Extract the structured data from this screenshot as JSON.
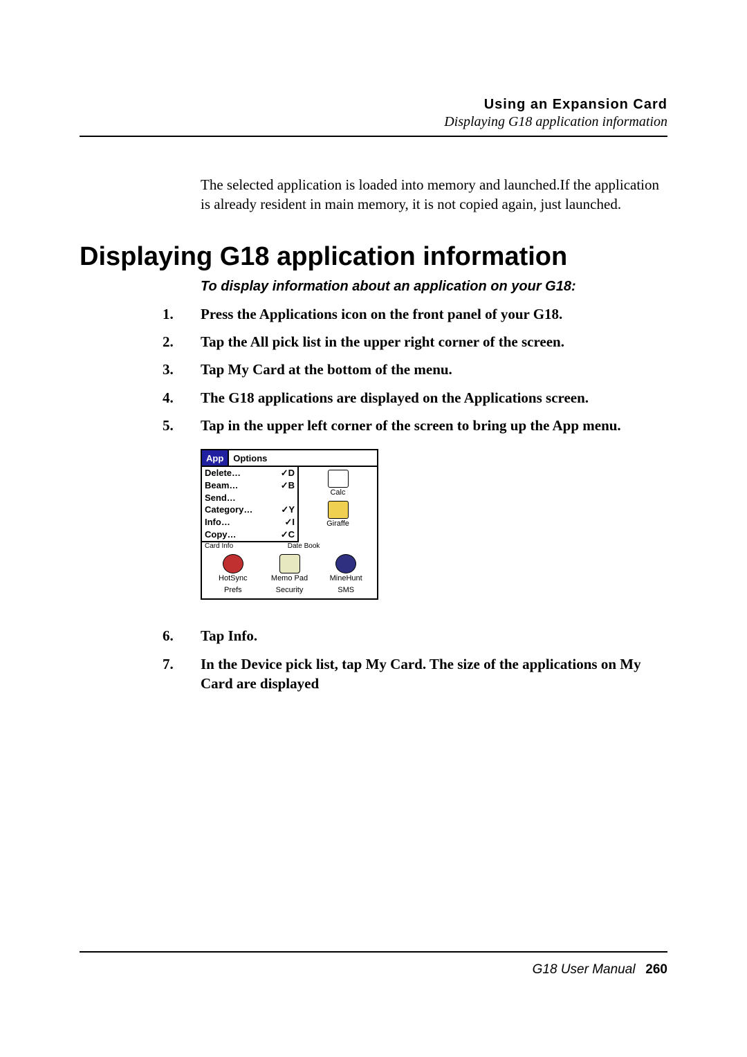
{
  "header": {
    "chapter": "Using an Expansion Card",
    "section": "Displaying G18 application information"
  },
  "intro": "The selected application is loaded into memory and launched.If the application is already resident in main memory, it is not copied again, just launched.",
  "heading": "Displaying G18 application information",
  "subhead": "To display information about an application on your  G18:",
  "steps1": [
    {
      "n": "1.",
      "t": "Press the Applications icon on the front panel of your G18."
    },
    {
      "n": "2.",
      "t": "Tap the All pick list in the upper right corner of the screen."
    },
    {
      "n": "3.",
      "t": "Tap My Card at the bottom of the menu."
    },
    {
      "n": "4.",
      "t": "The G18 applications are displayed on the Applications screen."
    },
    {
      "n": "5.",
      "t": "Tap in the upper left corner of the screen to bring up the App menu."
    }
  ],
  "palm": {
    "menubar": [
      "App",
      "Options"
    ],
    "menu": [
      {
        "l": "Delete…",
        "s": "✓D"
      },
      {
        "l": "Beam…",
        "s": "✓B"
      },
      {
        "l": "Send…",
        "s": ""
      },
      {
        "l": "Category…",
        "s": "✓Y"
      },
      {
        "l": "Info…",
        "s": "✓I"
      },
      {
        "l": "Copy…",
        "s": "✓C"
      }
    ],
    "rightApps": [
      "Calc",
      "Giraffe"
    ],
    "obscured": [
      "Card Info",
      "Date Book"
    ],
    "row2": [
      "HotSync",
      "Memo Pad",
      "MineHunt"
    ],
    "row3": [
      "Prefs",
      "Security",
      "SMS"
    ]
  },
  "steps2": [
    {
      "n": "6.",
      "t": "Tap Info."
    },
    {
      "n": "7.",
      "t": "In the Device pick list, tap My Card. The size of the applications on My Card are displayed"
    }
  ],
  "footer": {
    "manual": "G18 User Manual",
    "page": "260"
  }
}
